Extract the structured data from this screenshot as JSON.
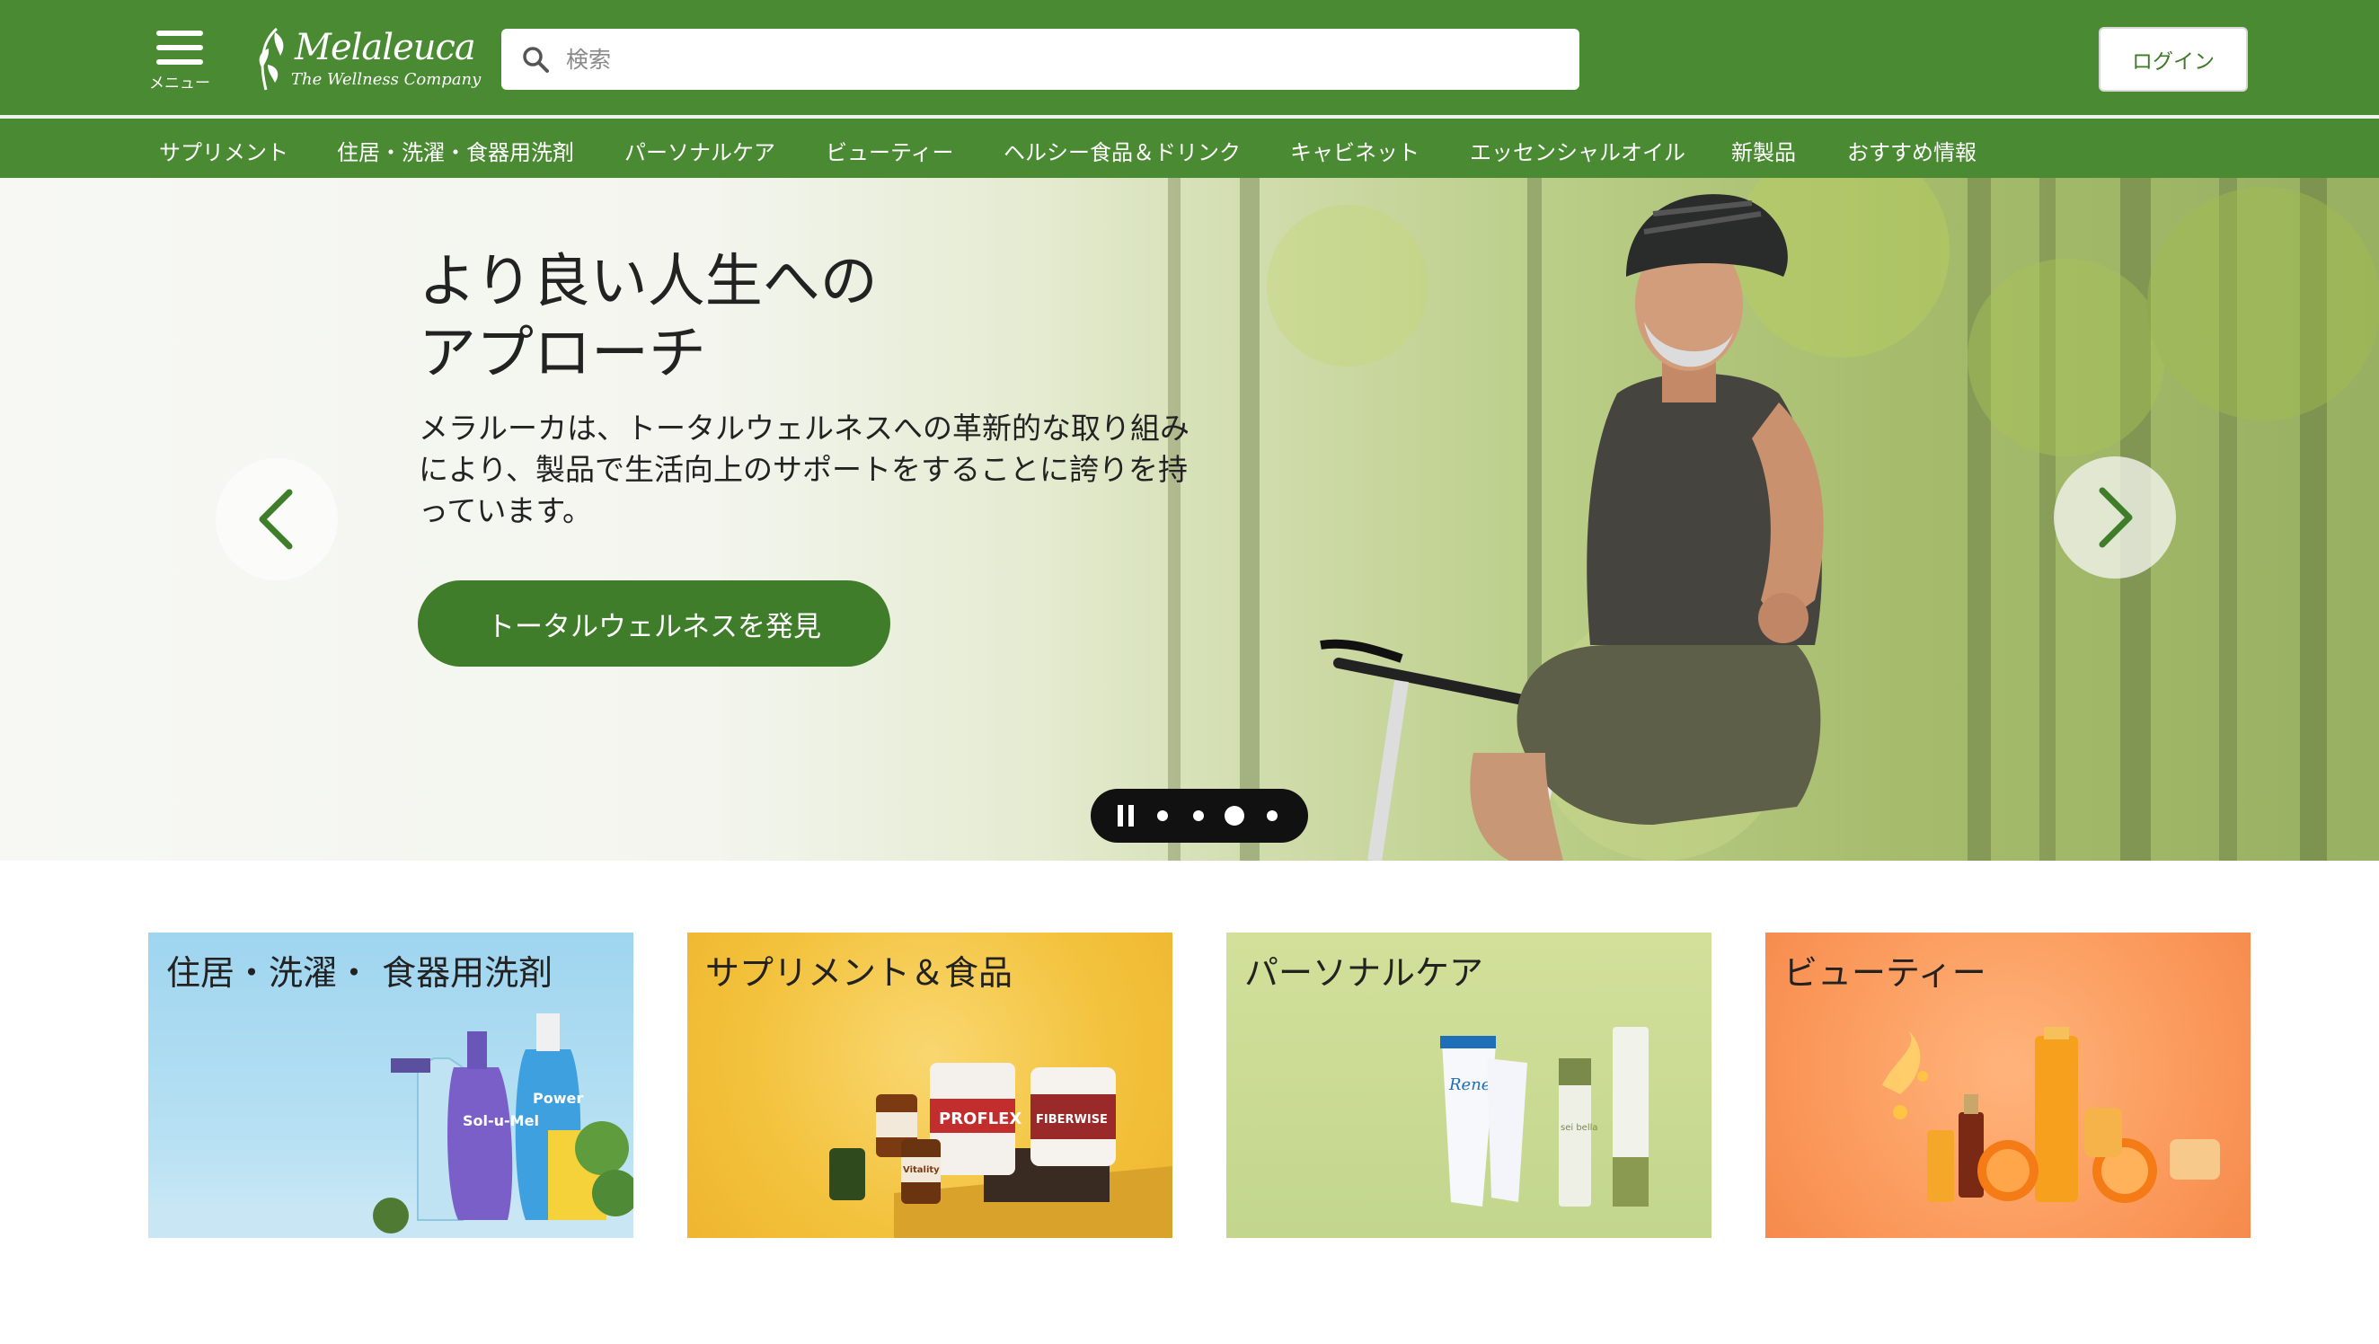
{
  "header": {
    "menu_label": "メニュー",
    "logo_brand": "Melaleuca",
    "logo_tagline": "The Wellness Company",
    "search_placeholder": "検索",
    "login_label": "ログイン",
    "colors": {
      "brand_green": "#4a8a32",
      "button_green": "#3f7d2a"
    }
  },
  "nav": {
    "items": [
      "サプリメント",
      "住居・洗濯・食器用洗剤",
      "パーソナルケア",
      "ビューティー",
      "ヘルシー食品＆ドリンク",
      "キャビネット",
      "エッセンシャルオイル",
      "新製品",
      "おすすめ情報"
    ]
  },
  "hero": {
    "title_line1": "より良い人生への",
    "title_line2": "アプローチ",
    "body": "メラルーカは、トータルウェルネスへの革新的な取り組みにより、製品で生活向上のサポートをすることに誇りを持っています。",
    "cta_label": "トータルウェルネスを発見",
    "carousel": {
      "slide_count": 4,
      "active_slide": 3
    }
  },
  "tiles": [
    {
      "label": "住居・洗濯・ 食器用洗剤",
      "image_product_text": [
        "Sol-u-Mel",
        "Power"
      ]
    },
    {
      "label": "サプリメント＆食品",
      "image_product_text": [
        "PROFLEX",
        "FIBERWISE",
        "Vitality"
      ]
    },
    {
      "label": "パーソナルケア",
      "image_product_text": [
        "Renew",
        "sei bella"
      ]
    },
    {
      "label": "ビューティー"
    }
  ]
}
